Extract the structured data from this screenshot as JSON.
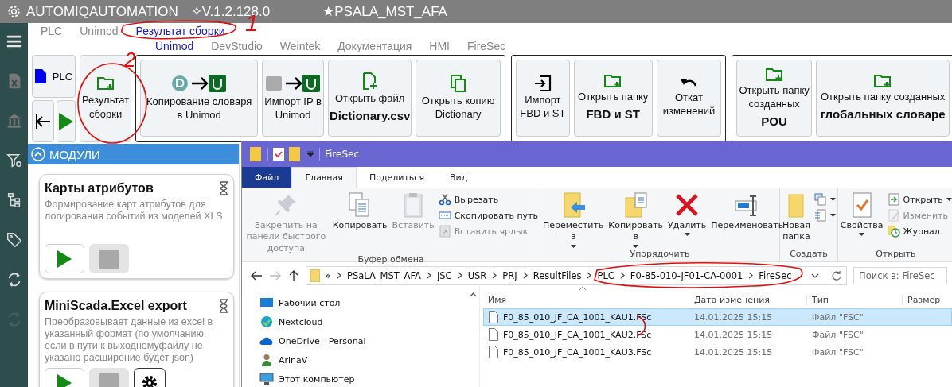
{
  "title_bar": {
    "app": "AUTOMIQAUTOMATION",
    "version": "✧V.1.2.128.0",
    "project": "★PSALA_MST_AFA"
  },
  "rail_items": [
    {
      "disabled": false
    },
    {
      "disabled": false
    },
    {
      "disabled": false
    },
    {
      "disabled": false
    },
    {
      "disabled": false
    },
    {
      "disabled": false
    },
    {
      "disabled": false
    },
    {
      "disabled": true
    }
  ],
  "nav_tabs": [
    {
      "label": "PLC",
      "selected": false
    },
    {
      "label": "Unimod",
      "selected": false
    },
    {
      "label": "Результат сборки",
      "selected": true
    }
  ],
  "sub_tabs": [
    {
      "label": "Unimod",
      "selected": true
    },
    {
      "label": "DevStudio",
      "selected": false
    },
    {
      "label": "Weintek",
      "selected": false
    },
    {
      "label": "Документация",
      "selected": false
    },
    {
      "label": "HMI",
      "selected": false
    },
    {
      "label": "FireSec",
      "selected": false
    }
  ],
  "toolbar": {
    "plc_button": "PLC",
    "result_button": "Результат сборки",
    "groups": [
      [
        {
          "text": "Копирование словаря в Unimod"
        },
        {
          "text": "Импорт IP в Unimod"
        },
        {
          "text": "Открыть файл",
          "strong": "Dictionary.csv"
        },
        {
          "text": "Открыть копию Dictionary"
        }
      ],
      [
        {
          "text": "Импорт FBD и ST"
        },
        {
          "text": "Открыть папку",
          "strong": "FBD и ST"
        },
        {
          "text": "Откат изменений"
        }
      ],
      [
        {
          "text": "Открыть папку созданных",
          "strong": "POU"
        },
        {
          "text": "Открыть папку созданных",
          "strong": "глобальных словаре"
        }
      ]
    ]
  },
  "modules": {
    "title": "МОДУЛИ",
    "cards": [
      {
        "title": "Карты атрибутов",
        "description": "Формирование карт атрибутов для логирования событий из моделей XLS",
        "buttons": [
          {
            "kind": "play",
            "disabled": false
          },
          {
            "kind": "stop",
            "disabled": true
          }
        ]
      },
      {
        "title": "MiniScada.Excel export",
        "description": "Преобразовывает данные из excel в указанный формат (по умолчанию, если в пути к выходномуфайлу не указано расширение будет json)",
        "buttons": [
          {
            "kind": "play",
            "disabled": false
          },
          {
            "kind": "stop",
            "disabled": true
          },
          {
            "kind": "settings",
            "disabled": false
          }
        ]
      }
    ]
  },
  "explorer": {
    "title": "FireSec",
    "tabs": [
      {
        "label": "Файл",
        "selected": false,
        "kind": "file"
      },
      {
        "label": "Главная",
        "selected": true,
        "kind": "tab"
      },
      {
        "label": "Поделиться",
        "selected": false,
        "kind": "tab"
      },
      {
        "label": "Вид",
        "selected": false,
        "kind": "tab"
      }
    ],
    "ribbon": [
      {
        "label": "Буфер обмена",
        "large": [
          {
            "label": "Закрепить на панели быстрого доступа",
            "disabled": true,
            "dropdown": false
          },
          {
            "label": "Копировать",
            "disabled": false,
            "dropdown": false
          },
          {
            "label": "Вставить",
            "disabled": true,
            "dropdown": false
          }
        ],
        "small": [
          {
            "label": "Вырезать",
            "disabled": false,
            "dropdown": false
          },
          {
            "label": "Скопировать путь",
            "disabled": false,
            "dropdown": false
          },
          {
            "label": "Вставить ярлык",
            "disabled": true,
            "dropdown": false
          }
        ]
      },
      {
        "label": "Упорядочить",
        "large": [
          {
            "label": "Переместить в",
            "disabled": false,
            "dropdown": true
          },
          {
            "label": "Копировать в",
            "disabled": false,
            "dropdown": true
          },
          {
            "label": "Удалить",
            "disabled": false,
            "dropdown": true
          },
          {
            "label": "Переименовать",
            "disabled": false,
            "dropdown": false
          }
        ]
      },
      {
        "label": "Создать",
        "large": [
          {
            "label": "Новая папка",
            "disabled": false,
            "dropdown": false
          }
        ],
        "small": [
          {
            "disabled": false,
            "dropdown": true
          },
          {
            "disabled": false,
            "dropdown": true
          }
        ]
      },
      {
        "label": "Открыть",
        "large": [
          {
            "label": "Свойства",
            "disabled": false,
            "dropdown": true
          }
        ],
        "small": [
          {
            "label": "Открыть",
            "disabled": false,
            "dropdown": true
          },
          {
            "label": "Изменить",
            "disabled": true,
            "dropdown": false
          },
          {
            "label": "Журнал",
            "disabled": false,
            "dropdown": false
          }
        ]
      }
    ],
    "path": [
      "«",
      "PSaLA_MST_AFA",
      "JSC",
      "USR",
      "PRJ",
      "ResultFiles",
      "PLC",
      "F0-85-010-JF01-CA-0001",
      "FireSec"
    ],
    "search": {
      "placeholder": "Поиск в: FireSec"
    },
    "nav_pane": [
      "Рабочий стол",
      "Nextcloud",
      "OneDrive - Personal",
      "ArinaV",
      "Этот компьютер"
    ],
    "columns": [
      "Имя",
      "Дата изменения",
      "Тип",
      "Размер"
    ],
    "files": [
      {
        "name": "F0_85_010_JF_CA_1001_KAU1.FSc",
        "date": "14.01.2025 15:15",
        "type": "Файл \"FSC\"",
        "selected": true
      },
      {
        "name": "F0_85_010_JF_CA_1001_KAU2.FSc",
        "date": "14.01.2025 15:15",
        "type": "Файл \"FSC\"",
        "selected": false
      },
      {
        "name": "F0_85_010_JF_CA_1001_KAU3.FSc",
        "date": "14.01.2025 15:15",
        "type": "Файл \"FSC\"",
        "selected": false
      }
    ]
  },
  "annotation_marks": [
    "1",
    "2"
  ]
}
